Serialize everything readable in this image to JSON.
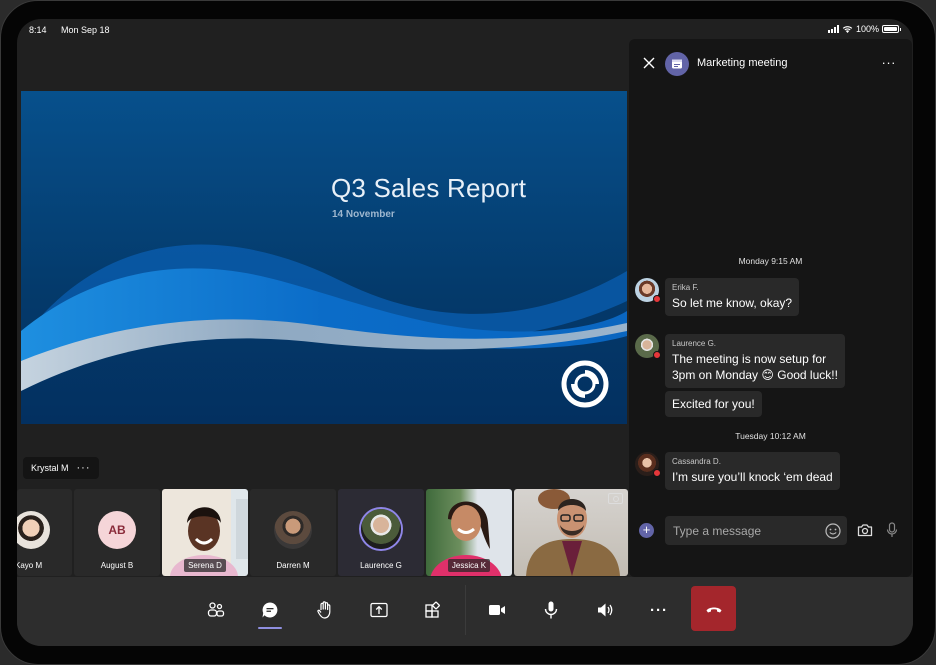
{
  "status_bar": {
    "time": "8:14",
    "date": "Mon Sep 18",
    "battery": "100%"
  },
  "slide": {
    "title": "Q3 Sales Report",
    "subtitle": "14 November"
  },
  "spotlight": {
    "name": "Krystal M",
    "more": "···"
  },
  "gallery": {
    "participants": [
      {
        "name": "Kayo M",
        "type": "avatar"
      },
      {
        "name": "August B",
        "type": "initials",
        "initials": "AB"
      },
      {
        "name": "Serena D",
        "type": "video"
      },
      {
        "name": "Darren M",
        "type": "avatar"
      },
      {
        "name": "Laurence G",
        "type": "avatar",
        "speaking": true
      },
      {
        "name": "Jessica K",
        "type": "video"
      },
      {
        "name": "",
        "type": "video",
        "self": true
      }
    ]
  },
  "chat": {
    "title": "Marketing meeting",
    "more": "···",
    "groups": [
      {
        "timestamp": "Monday 9:15 AM",
        "messages": [
          {
            "sender": "Erika F.",
            "lines": [
              "So let me know, okay?"
            ]
          },
          {
            "sender": "Laurence G.",
            "lines": [
              "The meeting is now setup for",
              "3pm on Monday 😊 Good luck!!"
            ]
          },
          {
            "sender": "",
            "lines": [
              "Excited for you!"
            ]
          }
        ]
      },
      {
        "timestamp": "Tuesday 10:12 AM",
        "messages": [
          {
            "sender": "Cassandra D.",
            "lines": [
              "I’m sure you’ll knock ‘em dead"
            ]
          }
        ]
      }
    ],
    "composer": {
      "placeholder": "Type a message",
      "add": "+"
    }
  },
  "controls": {
    "items": [
      "participants",
      "chat",
      "raise-hand",
      "share",
      "apps",
      "camera",
      "mic",
      "speaker",
      "more",
      "hang-up"
    ],
    "active": "chat",
    "more_label": "···"
  },
  "colors": {
    "accent": "#6264a7",
    "hangup": "#a4262c",
    "presence_busy": "#e5373a"
  }
}
